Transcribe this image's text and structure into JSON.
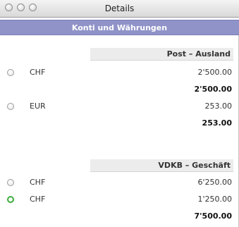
{
  "window": {
    "title": "Details"
  },
  "section": {
    "title": "Konti und Währungen"
  },
  "groups": [
    {
      "header": "Post – Ausland",
      "rows": [
        {
          "currency": "CHF",
          "amount": "2'500.00",
          "selected": false
        },
        {
          "total": "2'500.00"
        },
        {
          "currency": "EUR",
          "amount": "253.00",
          "selected": false
        },
        {
          "total": "253.00"
        }
      ]
    },
    {
      "header": "VDKB – Geschäft",
      "rows": [
        {
          "currency": "CHF",
          "amount": "6'250.00",
          "selected": false
        },
        {
          "currency": "CHF",
          "amount": "1'250.00",
          "selected": true
        },
        {
          "total": "7'500.00"
        }
      ]
    }
  ],
  "colors": {
    "section_bar": "#8f93c8",
    "radio_selected": "#3fae3f"
  }
}
